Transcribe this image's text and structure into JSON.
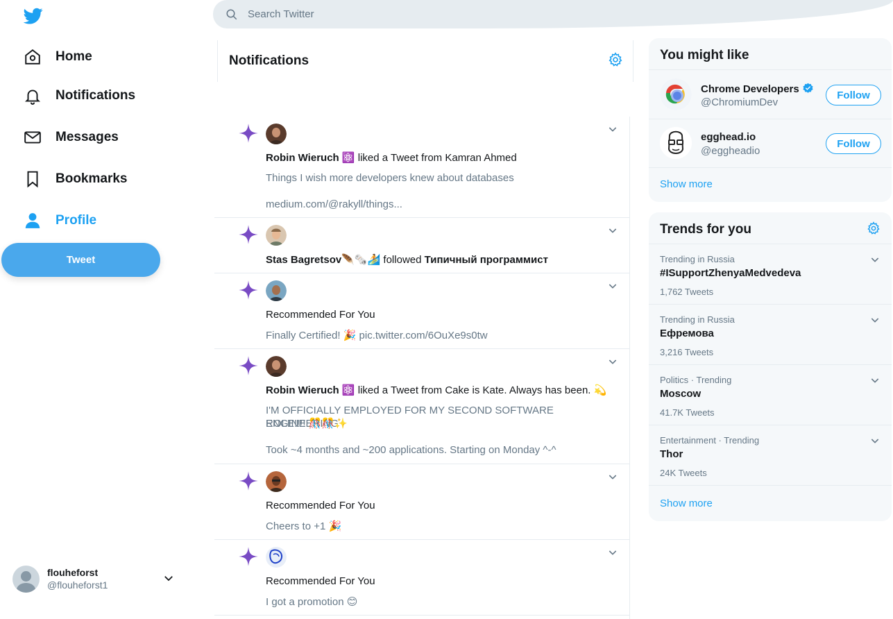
{
  "sidebar": {
    "nav": [
      {
        "label": "Home",
        "icon": "home-icon"
      },
      {
        "label": "Notifications",
        "icon": "bell-icon"
      },
      {
        "label": "Messages",
        "icon": "envelope-icon"
      },
      {
        "label": "Bookmarks",
        "icon": "bookmark-icon"
      },
      {
        "label": "Profile",
        "icon": "person-icon",
        "active": true
      }
    ],
    "tweet_button": "Tweet",
    "account": {
      "display_name": "flouheforst",
      "handle": "@flouheforst1"
    }
  },
  "search": {
    "placeholder": "Search Twitter"
  },
  "main": {
    "title": "Notifications",
    "notifications": [
      {
        "actor": "Robin Wieruch",
        "actor_emoji": "⚛️",
        "action": "liked a Tweet from Kamran Ahmed",
        "lines": [
          "Things I wish more developers knew about databases",
          "",
          "medium.com/@rakyll/things..."
        ]
      },
      {
        "actor": "Stas Bagretsov",
        "actor_emoji": "🪶🗞️🏄",
        "action": "followed",
        "target": "Типичный программист",
        "lines": []
      },
      {
        "actor": "",
        "actor_emoji": "",
        "action": "Recommended For You",
        "lines": [
          "Finally Certified! 🎉 pic.twitter.com/6OuXe9s0tw"
        ]
      },
      {
        "actor": "Robin Wieruch",
        "actor_emoji": "⚛️",
        "action": "liked a Tweet from Cake is Kate. Always has been. 💫",
        "lines": [
          "I'M OFFICIALLY EMPLOYED FOR MY SECOND SOFTWARE ENGINEERING",
          "ROLE!!!! 🎊🎊✨",
          "",
          "Took ~4 months and ~200 applications. Starting on Monday ^-^"
        ]
      },
      {
        "actor": "",
        "actor_emoji": "",
        "action": "Recommended For You",
        "lines": [
          "Cheers to +1 🎉"
        ]
      },
      {
        "actor": "",
        "actor_emoji": "",
        "action": "Recommended For You",
        "lines": [
          "I got a promotion 😊"
        ]
      }
    ]
  },
  "who_to_follow": {
    "title": "You might like",
    "accounts": [
      {
        "name": "Chrome Developers",
        "handle": "@ChromiumDev",
        "verified": true,
        "button": "Follow"
      },
      {
        "name": "egghead.io",
        "handle": "@eggheadio",
        "verified": false,
        "button": "Follow"
      }
    ],
    "show_more": "Show more"
  },
  "trends": {
    "title": "Trends for you",
    "items": [
      {
        "context": "Trending in Russia",
        "name": "#ISupportZhenyaMedvedeva",
        "count": "1,762 Tweets"
      },
      {
        "context": "Trending in Russia",
        "name": "Ефремова",
        "count": "3,216 Tweets"
      },
      {
        "context": "Politics · Trending",
        "name": "Moscow",
        "count": "41.7K Tweets"
      },
      {
        "context": "Entertainment · Trending",
        "name": "Thor",
        "count": "24K Tweets"
      }
    ],
    "show_more": "Show more"
  },
  "colors": {
    "accent": "#1da1f2",
    "star": "#794bc4",
    "tweet_button": "#4aa8ec"
  }
}
